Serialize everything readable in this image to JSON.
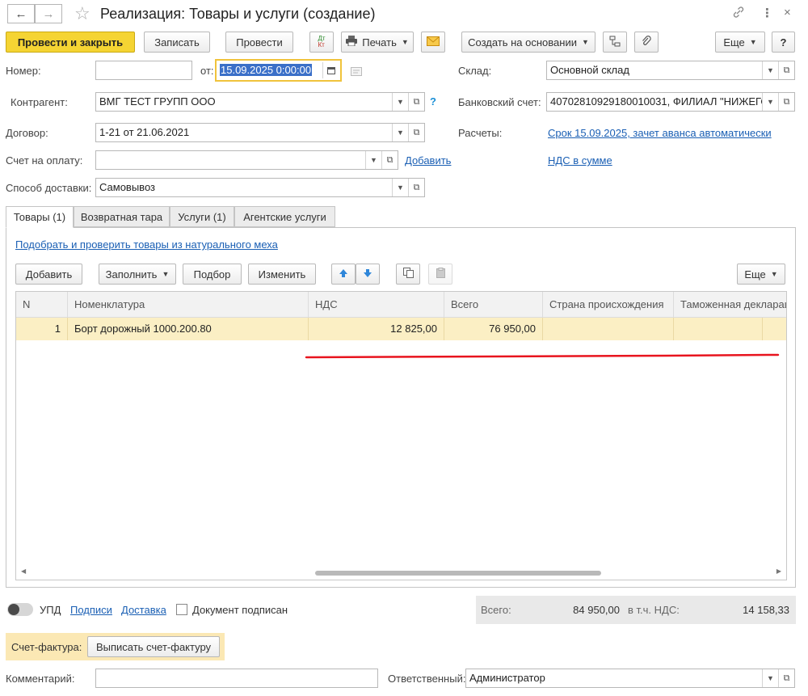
{
  "window": {
    "title": "Реализация: Товары и услуги (создание)",
    "back_icon": "←",
    "forward_icon": "→",
    "star_icon": "☆",
    "link_icon": "🔗",
    "more_icon": "⋮",
    "close_icon": "×"
  },
  "toolbar": {
    "post_close": "Провести и закрыть",
    "save": "Записать",
    "post": "Провести",
    "dtkt_top": "Дт",
    "dtkt_bottom": "Кт",
    "print": "Печать",
    "create_based": "Создать на основании",
    "more": "Еще",
    "help": "?"
  },
  "form": {
    "number_label": "Номер:",
    "number_value": "",
    "date_label": "от:",
    "date_value": "15.09.2025  0:00:00",
    "warehouse_label": "Склад:",
    "warehouse_value": "Основной склад",
    "contractor_label": "Контрагент:",
    "contractor_value": "ВМГ ТЕСТ ГРУПП ООО",
    "contractor_help": "?",
    "bank_label": "Банковский счет:",
    "bank_value": "40702810929180010031, ФИЛИАЛ \"НИЖЕГО",
    "contract_label": "Договор:",
    "contract_value": "1-21 от 21.06.2021",
    "settlements_label": "Расчеты:",
    "settlements_link": "Срок 15.09.2025, зачет аванса автоматически",
    "invoice_label": "Счет на оплату:",
    "invoice_value": "",
    "invoice_add": "Добавить",
    "vat_link": "НДС в сумме",
    "delivery_label": "Способ доставки:",
    "delivery_value": "Самовывоз"
  },
  "tabs": [
    {
      "label": "Товары (1)"
    },
    {
      "label": "Возвратная тара"
    },
    {
      "label": "Услуги (1)"
    },
    {
      "label": "Агентские услуги"
    }
  ],
  "goods": {
    "pick_link": "Подобрать и проверить товары из натурального меха",
    "add": "Добавить",
    "fill": "Заполнить",
    "select": "Подбор",
    "change": "Изменить",
    "more": "Еще",
    "columns": [
      "N",
      "Номенклатура",
      "НДС",
      "Всего",
      "Страна происхождения",
      "Таможенная деклараци"
    ],
    "rows": [
      {
        "n": "1",
        "name": "Борт дорожный 1000.200.80",
        "vat": "12 825,00",
        "total": "76 950,00",
        "country": "",
        "customs": ""
      }
    ]
  },
  "footer": {
    "upd_label": "УПД",
    "signatures_link": "Подписи",
    "delivery_link": "Доставка",
    "signed_label": "Документ подписан",
    "total_label": "Всего:",
    "total_value": "84 950,00",
    "vat_label": "в т.ч. НДС:",
    "vat_value": "14 158,33",
    "sf_label": "Счет-фактура:",
    "sf_button": "Выписать счет-фактуру",
    "comment_label": "Комментарий:",
    "comment_value": "",
    "responsible_label": "Ответственный:",
    "responsible_value": "Администратор"
  },
  "colors": {
    "primary": "#f5d433",
    "link": "#1a5fb4",
    "selected_row": "#fbefc4",
    "annotation_line": "#e8141e"
  }
}
